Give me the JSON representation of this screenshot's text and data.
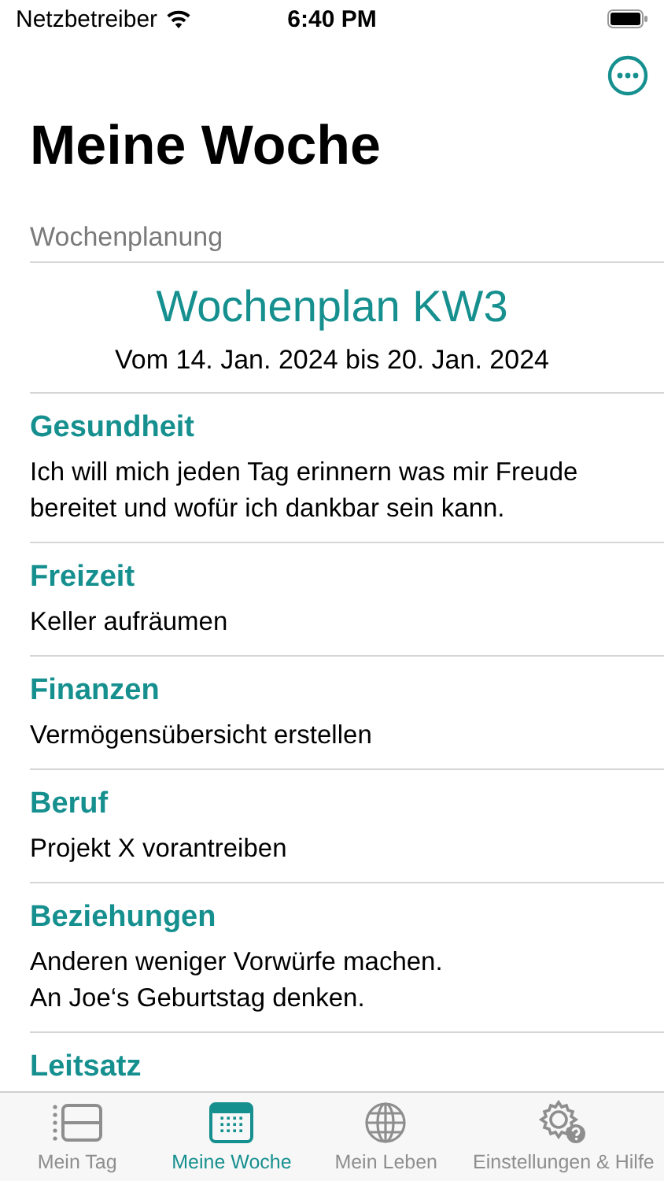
{
  "status_bar": {
    "carrier": "Netzbetreiber",
    "time": "6:40 PM"
  },
  "title": "Meine Woche",
  "section_header": "Wochenplanung",
  "plan": {
    "title": "Wochenplan KW3",
    "dates": "Vom 14. Jan. 2024 bis 20. Jan. 2024"
  },
  "entries": [
    {
      "category": "Gesundheit",
      "text": "Ich will mich jeden Tag erinnern was mir Freude bereitet und wofür ich dankbar sein kann."
    },
    {
      "category": "Freizeit",
      "text": "Keller aufräumen"
    },
    {
      "category": "Finanzen",
      "text": "Vermögensübersicht erstellen"
    },
    {
      "category": "Beruf",
      "text": "Projekt X vorantreiben"
    },
    {
      "category": "Beziehungen",
      "text": "Anderen weniger Vorwürfe machen.\nAn Joe‘s Geburtstag denken."
    },
    {
      "category": "Leitsatz"
    }
  ],
  "tabs": [
    {
      "kind": "day",
      "label": "Mein Tag",
      "selected": false
    },
    {
      "kind": "week",
      "label": "Meine Woche",
      "selected": true
    },
    {
      "kind": "life",
      "label": "Mein Leben",
      "selected": false
    },
    {
      "kind": "settings",
      "label": "Einstellungen & Hilfe",
      "selected": false
    }
  ]
}
